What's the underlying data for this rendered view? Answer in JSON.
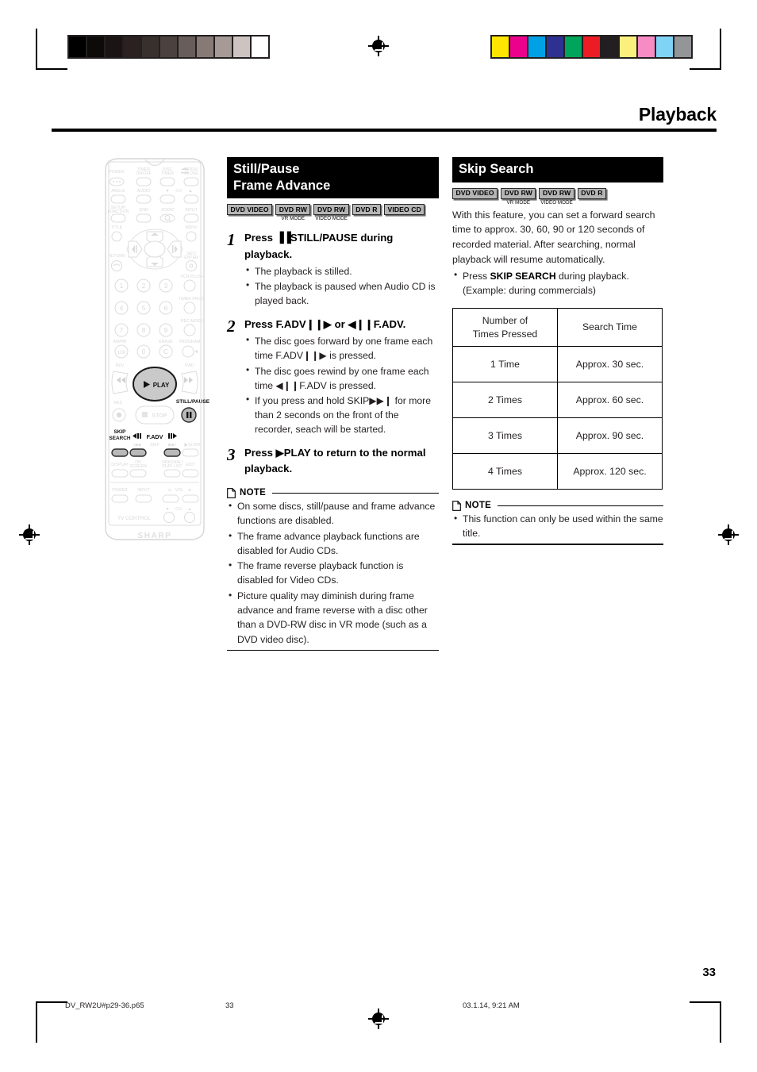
{
  "page": {
    "header_title": "Playback",
    "page_number": "33"
  },
  "colorbars": {
    "left": [
      "#000000",
      "#0d0a0a",
      "#1a1414",
      "#2b2121",
      "#38302d",
      "#4b423f",
      "#685d5a",
      "#877a76",
      "#a59a96",
      "#cdc3c1",
      "#ffffff"
    ],
    "right": [
      "#ffe600",
      "#ec018c",
      "#00a0e4",
      "#2e3192",
      "#00a45a",
      "#ed1c24",
      "#231f20",
      "#fbef7d",
      "#f78cc4",
      "#7fd4f5",
      "#939598"
    ]
  },
  "left_column": {
    "section_title_line1": "Still/Pause",
    "section_title_line2": "Frame Advance",
    "badges": [
      {
        "label": "DVD VIDEO",
        "sub": ""
      },
      {
        "label": "DVD RW",
        "sub": "VR MODE"
      },
      {
        "label": "DVD RW",
        "sub": "VIDEO MODE"
      },
      {
        "label": "DVD R",
        "sub": ""
      },
      {
        "label": "VIDEO CD",
        "sub": ""
      }
    ],
    "steps": [
      {
        "num": "1",
        "title_pre": "Press ",
        "title_sym": "▐▐",
        "title_mid": "STILL/PAUSE",
        "title_post": " during playback.",
        "bullets": [
          "The playback is stilled.",
          "The playback is paused when Audio CD is played back."
        ]
      },
      {
        "num": "2",
        "title_full": "Press F.ADV❙❙▶ or ◀❙❙F.ADV.",
        "bullets": [
          "The disc goes forward by one frame each time F.ADV❙❙▶ is pressed.",
          "The disc goes rewind by one frame each time ◀❙❙F.ADV is pressed.",
          "If you press and hold SKIP▶▶❙ for more than 2 seconds on the front of the recorder, seach will be started."
        ]
      },
      {
        "num": "3",
        "title_full": "Press ▶PLAY to return to the normal playback.",
        "bullets": []
      }
    ],
    "note": {
      "label": "NOTE",
      "items": [
        "On some discs, still/pause and frame advance functions are disabled.",
        "The frame advance playback functions are disabled for Audio CDs.",
        "The frame reverse playback function is disabled for Video CDs.",
        "Picture quality may diminish during frame advance and frame reverse with a disc other than a DVD-RW disc in VR mode (such as a DVD video disc)."
      ]
    }
  },
  "right_column": {
    "section_title": "Skip Search",
    "badges": [
      {
        "label": "DVD VIDEO",
        "sub": ""
      },
      {
        "label": "DVD RW",
        "sub": "VR MODE"
      },
      {
        "label": "DVD RW",
        "sub": "VIDEO MODE"
      },
      {
        "label": "DVD R",
        "sub": ""
      }
    ],
    "body_text": "With this feature, you can set a forward search time to approx. 30, 60, 90 or 120 seconds of recorded material. After searching, normal playback will resume automatically.",
    "bullet_line1_pre": "Press ",
    "bullet_line1_bold": "SKIP SEARCH",
    "bullet_line1_post": " during playback.",
    "bullet_line2": "(Example: during commercials)",
    "table": {
      "headers": [
        "Number of\nTimes Pressed",
        "Search Time"
      ],
      "header_col1_line1": "Number of",
      "header_col1_line2": "Times Pressed",
      "header_col2": "Search Time",
      "rows": [
        {
          "times": "1 Time",
          "search_time": "Approx. 30 sec."
        },
        {
          "times": "2 Times",
          "search_time": "Approx. 60 sec."
        },
        {
          "times": "3 Times",
          "search_time": "Approx. 90 sec."
        },
        {
          "times": "4 Times",
          "search_time": "Approx. 120 sec."
        }
      ]
    },
    "note": {
      "label": "NOTE",
      "items": [
        "This function can only be used within the same title."
      ]
    }
  },
  "remote": {
    "brand": "SHARP",
    "callouts": {
      "play": "▶ PLAY",
      "still_pause": "STILL/PAUSE",
      "skip_search_line1": "SKIP",
      "skip_search_line2": "SEARCH",
      "f_adv": "◀❙❙F.ADV❙❙▶",
      "stop": "■ STOP"
    },
    "keys": {
      "power": "POWER",
      "timer_onoff_l1": "TIMER",
      "timer_onoff_l2": "ON/OFF",
      "disc_l1": "DISC",
      "disc_l2": "TIMER",
      "open_l1": "OPEN/",
      "open_l2": "CLOSE",
      "angle": "ANGLE",
      "audio": "AUDIO",
      "ch": "CH",
      "setup_l1": "SETUP/",
      "setup_l2": "FUNCTION",
      "dnr": "DNR",
      "zoom": "ZOOM",
      "input": "INPUT",
      "title": "TITLE",
      "menu": "MENU",
      "return": "RETURN",
      "set_l1": "SET/",
      "set_l2": "ENTER",
      "vcr_plus": "VCR PLUS+",
      "timer_prog": "TIMER PROG.",
      "rec_mode": "REC MODE",
      "ampm": "AM/PM",
      "erase": "ERASE",
      "program": "PROGRAM",
      "rev": "REV",
      "fwd": "FWD",
      "rec": "REC",
      "skip": "SKIP",
      "slow": "SLOW",
      "display": "DISPLAY",
      "on_screen_l1": "ON",
      "on_screen_l2": "SCREEN",
      "original_l1": "ORIGINAL/",
      "original_l2": "PLAY LIST",
      "edit": "EDIT",
      "tv_power": "POWER",
      "tv_input": "INPUT",
      "vol": "VOL",
      "tv_control": "TV CONTROL",
      "numbers": [
        "1",
        "2",
        "3",
        "4",
        "5",
        "6",
        "7",
        "8",
        "9",
        "100",
        "0",
        "C"
      ]
    }
  },
  "footer": {
    "file_name": "DV_RW2U#p29-36.p65",
    "page": "33",
    "timestamp": "03.1.14, 9:21 AM"
  }
}
